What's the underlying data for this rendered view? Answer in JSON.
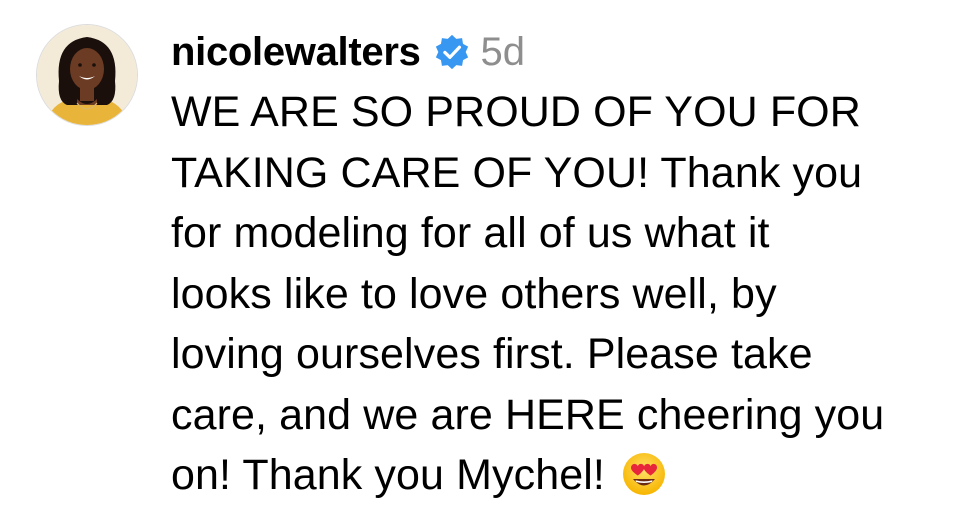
{
  "comment": {
    "avatar": {
      "icon": "profile-photo",
      "alt": "nicolewalters",
      "colors": {
        "bg": "#e9b43a",
        "skin": "#6b3b24",
        "hair": "#1a0f0a"
      }
    },
    "username": "nicolewalters",
    "verified_icon": "verified-badge-icon",
    "verified_color": "#3897f0",
    "time_ago": "5d",
    "lines": [
      "WE ARE SO PROUD OF YOU FOR",
      "TAKING CARE OF YOU! Thank you",
      "for modeling for all of us what it",
      "looks like to love others well, by",
      "loving ourselves first. Please take",
      "care, and we are HERE cheering you",
      "on! Thank you Mychel!"
    ],
    "trailing_emoji": "heart-eyes-emoji"
  }
}
